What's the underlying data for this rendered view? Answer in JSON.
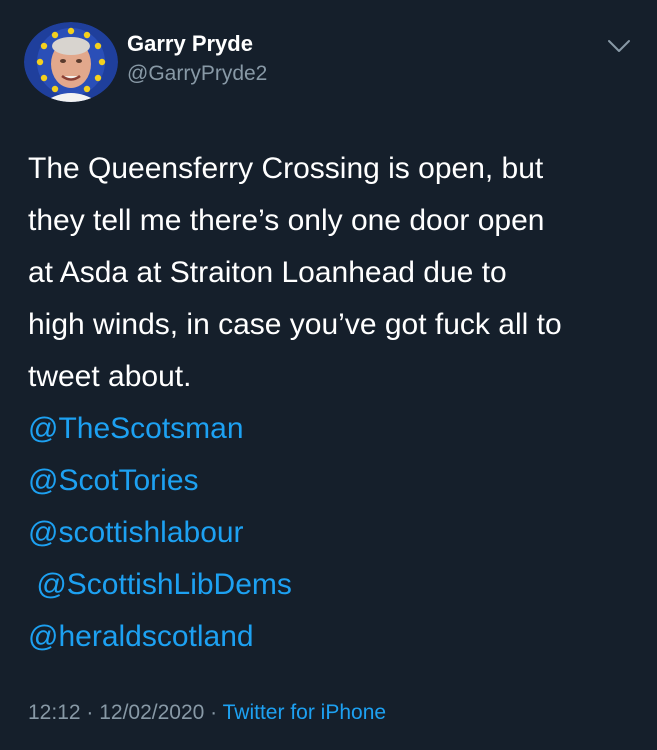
{
  "tweet": {
    "author": {
      "name": "Garry Pryde",
      "handle": "@GarryPryde2"
    },
    "body_lines": [
      "The Queensferry Crossing is open, but",
      "they tell me there’s only one door open",
      "at Asda at Straiton Loanhead due to",
      "high winds, in case you’ve got fuck all to",
      "tweet about."
    ],
    "mentions": [
      "@TheScotsman",
      "@ScotTories",
      "@scottishlabour",
      " @ScottishLibDems",
      "@heraldscotland"
    ],
    "time": "12:12",
    "separator": " · ",
    "date": "12/02/2020",
    "source": "Twitter for iPhone",
    "icons": {
      "menu": "chevron-down-icon",
      "avatar": "avatar"
    },
    "colors": {
      "background": "#151f2b",
      "link": "#1da1f2",
      "secondary_text": "#8899a6",
      "primary_text": "#ffffff"
    }
  }
}
